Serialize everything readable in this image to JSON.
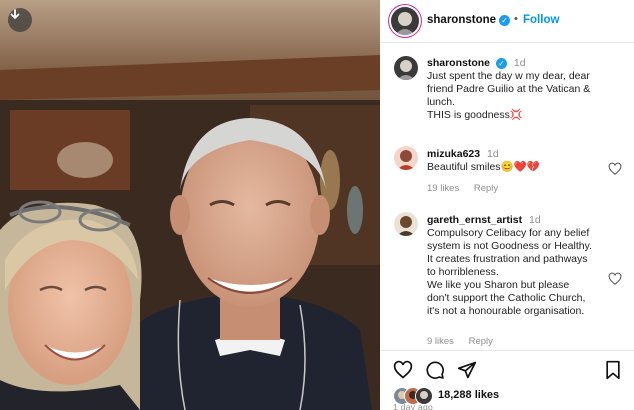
{
  "header": {
    "username": "sharonstone",
    "separator": "•",
    "follow_label": "Follow"
  },
  "caption": {
    "username": "sharonstone",
    "time": "1d",
    "lines": [
      "Just spent the day w my dear, dear",
      "friend Padre Guilio at the Vatican &",
      "lunch.",
      "THIS is goodness💢"
    ]
  },
  "comments": [
    {
      "username": "mizuka623",
      "time": "1d",
      "lines": [
        "Beautiful smiles😊❤️💔"
      ],
      "likes": "19 likes",
      "reply_label": "Reply"
    },
    {
      "username": "gareth_ernst_artist",
      "time": "1d",
      "lines": [
        "Compulsory Celibacy for any belief",
        "system is not Goodness or Healthy.",
        "It creates frustration and pathways",
        "to horribleness.",
        "We like you Sharon but please",
        "don't support the Catholic Church,",
        "it's not a honourable organisation."
      ],
      "likes": "9 likes",
      "reply_label": "Reply"
    }
  ],
  "footer": {
    "likes_count": "18,288 likes",
    "date": "1 day ago"
  },
  "icons": {
    "download": "download-arrow-icon",
    "verified": "verified-badge-icon",
    "like": "heart-icon",
    "comment": "comment-bubble-icon",
    "share": "paper-plane-icon",
    "save": "bookmark-icon"
  },
  "colors": {
    "link": "#0095f6",
    "verified": "#1d9bf0",
    "muted": "#8e8e8e"
  }
}
